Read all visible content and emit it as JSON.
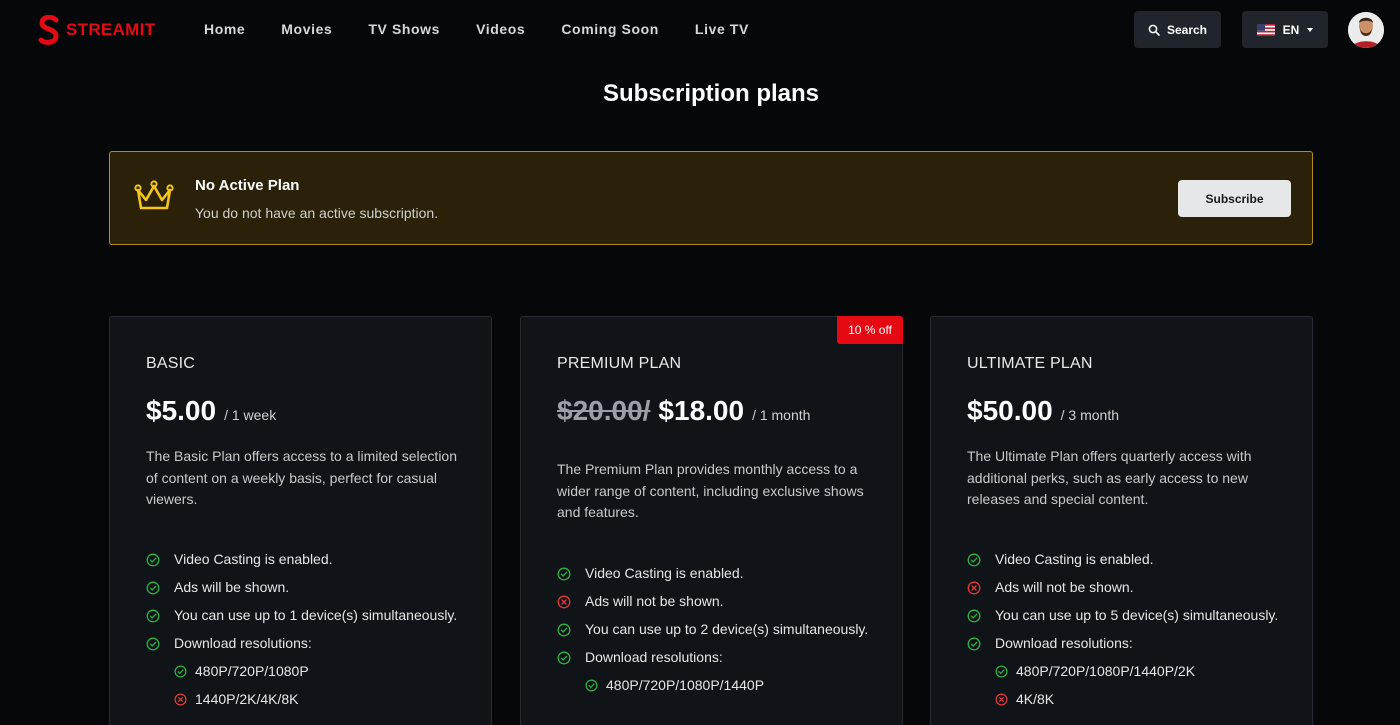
{
  "header": {
    "logo_text": "STREAMIT",
    "nav": [
      "Home",
      "Movies",
      "TV Shows",
      "Videos",
      "Coming Soon",
      "Live TV"
    ],
    "search_label": "Search",
    "language": "EN",
    "search_icon": "search-icon",
    "flag_icon": "us-flag-icon"
  },
  "page": {
    "title": "Subscription plans"
  },
  "active_plan": {
    "title": "No Active Plan",
    "text": "You do not have an active subscription.",
    "button": "Subscribe",
    "icon": "crown-icon"
  },
  "colors": {
    "brand": "#e50914",
    "check": "#2fb344",
    "cross": "#e5393a",
    "banner_border": "#b08d1a"
  },
  "plans": [
    {
      "name": "BASIC",
      "price": "$5.00",
      "period": "/ 1 week",
      "description": "The Basic Plan offers access to a limited selection of content on a weekly basis, perfect for casual viewers.",
      "features": [
        {
          "text": "Video Casting is enabled.",
          "enabled": true
        },
        {
          "text": "Ads will be shown.",
          "enabled": true
        },
        {
          "text": "You can use up to 1 device(s) simultaneously.",
          "enabled": true
        },
        {
          "text": "Download resolutions:",
          "enabled": true
        }
      ],
      "resolutions": [
        {
          "text": "480P/720P/1080P",
          "enabled": true
        },
        {
          "text": "1440P/2K/4K/8K",
          "enabled": false
        }
      ]
    },
    {
      "name": "PREMIUM PLAN",
      "old_price": "$20.00/",
      "price": "$18.00",
      "period": "/ 1 month",
      "badge": "10 % off",
      "description": "The Premium Plan provides monthly access to a wider range of content, including exclusive shows and features.",
      "features": [
        {
          "text": "Video Casting is enabled.",
          "enabled": true
        },
        {
          "text": "Ads will not be shown.",
          "enabled": false
        },
        {
          "text": "You can use up to 2 device(s) simultaneously.",
          "enabled": true
        },
        {
          "text": "Download resolutions:",
          "enabled": true
        }
      ],
      "resolutions": [
        {
          "text": "480P/720P/1080P/1440P",
          "enabled": true
        }
      ]
    },
    {
      "name": "ULTIMATE PLAN",
      "price": "$50.00",
      "period": "/ 3 month",
      "description": "The Ultimate Plan offers quarterly access with additional perks, such as early access to new releases and special content.",
      "features": [
        {
          "text": "Video Casting is enabled.",
          "enabled": true
        },
        {
          "text": "Ads will not be shown.",
          "enabled": false
        },
        {
          "text": "You can use up to 5 device(s) simultaneously.",
          "enabled": true
        },
        {
          "text": "Download resolutions:",
          "enabled": true
        }
      ],
      "resolutions": [
        {
          "text": "480P/720P/1080P/1440P/2K",
          "enabled": true
        },
        {
          "text": "4K/8K",
          "enabled": false
        }
      ]
    }
  ]
}
